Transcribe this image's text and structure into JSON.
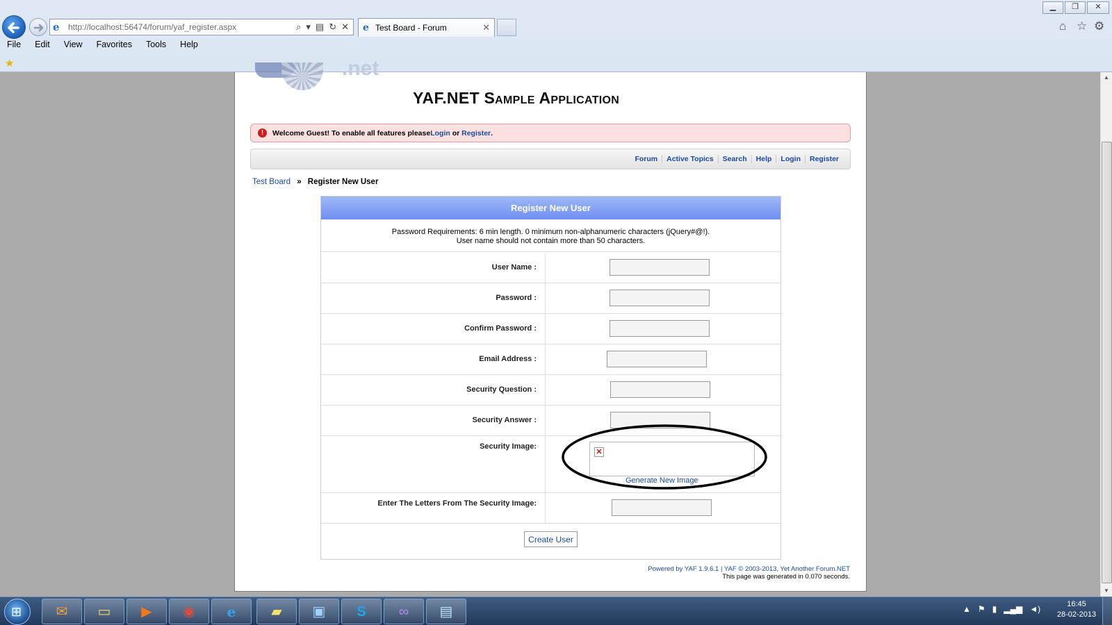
{
  "browser": {
    "address_url": "http://localhost:56474/forum/yaf_register.aspx",
    "tab_title": "Test Board - Forum",
    "menu": [
      "File",
      "Edit",
      "View",
      "Favorites",
      "Tools",
      "Help"
    ],
    "window_controls": {
      "minimize": "▁",
      "maximize": "❐",
      "close": "✕"
    }
  },
  "site": {
    "title": "YAF.NET Sample Application",
    "logo_text": ".net"
  },
  "welcome": {
    "prefix": "Welcome Guest! To enable all features please ",
    "login": "Login",
    "or": " or ",
    "register": "Register",
    "suffix": "."
  },
  "forum_nav": [
    "Forum",
    "Active Topics",
    "Search",
    "Help",
    "Login",
    "Register"
  ],
  "breadcrumb": {
    "board": "Test Board",
    "separator": "»",
    "current": "Register New User"
  },
  "form": {
    "header": "Register New User",
    "requirements_line1": "Password Requirements: 6 min length. 0 minimum non-alphanumeric characters (jQuery#@!).",
    "requirements_line2": "User name should not contain more than 50 characters.",
    "fields": {
      "username": "User Name :",
      "password": "Password :",
      "confirm_password": "Confirm Password :",
      "email": "Email Address :",
      "security_question": "Security Question :",
      "security_answer": "Security Answer :",
      "security_image": "Security Image:",
      "captcha_entry": "Enter The Letters From The Security Image:"
    },
    "generate_new_image": "Generate New Image",
    "submit": "Create User"
  },
  "footer": {
    "powered": "Powered by YAF 1.9.6.1 | YAF © 2003-2013, Yet Another Forum.NET",
    "generated": "This page was generated in 0.070 seconds."
  },
  "taskbar": {
    "clock_time": "16:45",
    "clock_date": "28-02-2013",
    "apps": [
      "outlook-icon",
      "explorer-icon",
      "media-player-icon",
      "chrome-icon",
      "ie-icon",
      "notes-icon",
      "remote-desktop-icon",
      "skype-icon",
      "visual-studio-icon",
      "photo-viewer-icon"
    ]
  },
  "icons": {
    "back": "back-arrow-icon",
    "forward": "forward-arrow-icon",
    "home": "home-icon",
    "favorites": "star-icon",
    "tools": "gear-icon",
    "warning": "warning-icon"
  },
  "colors": {
    "link": "#1a4aa0",
    "welcome_bg": "#fde0e0",
    "form_header": "#7f9cf2",
    "annotation": "#000000"
  }
}
